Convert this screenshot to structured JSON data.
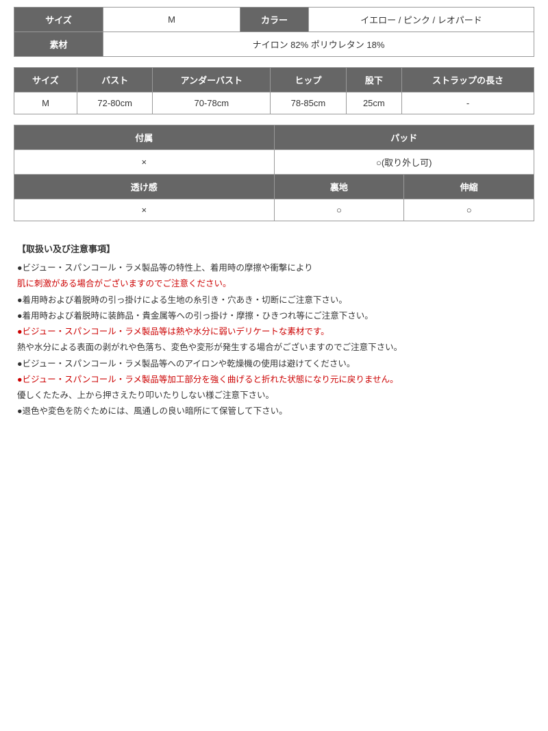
{
  "table1": {
    "row1": {
      "size_label": "サイズ",
      "size_value": "M",
      "color_label": "カラー",
      "color_value": "イエロー / ピンク / レオパード"
    },
    "row2": {
      "material_label": "素材",
      "material_value": "ナイロン 82%  ポリウレタン 18%"
    }
  },
  "table2": {
    "headers": [
      "サイズ",
      "バスト",
      "アンダーバスト",
      "ヒップ",
      "股下",
      "ストラップの長さ"
    ],
    "rows": [
      [
        "M",
        "72-80cm",
        "70-78cm",
        "78-85cm",
        "25cm",
        "-"
      ]
    ]
  },
  "table3": {
    "row1_headers": [
      "付属",
      "パッド"
    ],
    "row1_values": [
      "×",
      "○(取り外し可)"
    ],
    "row2_headers": [
      "透け感",
      "裏地",
      "伸縮"
    ],
    "row2_values": [
      "×",
      "○",
      "○"
    ]
  },
  "notes": {
    "title": "【取扱い及び注意事項】",
    "items": [
      {
        "text": "●ビジュー・スパンコール・ラメ製品等の特性上、着用時の摩擦や衝撃により",
        "red": false
      },
      {
        "text": "肌に刺激がある場合がございますのでご注意ください。",
        "red": true
      },
      {
        "text": "●着用時および着脱時の引っ掛けによる生地の糸引き・穴あき・切断にご注意下さい。",
        "red": false
      },
      {
        "text": "●着用時および着脱時に装飾品・貴金属等への引っ掛け・摩擦・ひきつれ等にご注意下さい。",
        "red": false
      },
      {
        "text": "●ビジュー・スパンコール・ラメ製品等は熱や水分に弱いデリケートな素材です。",
        "red": true
      },
      {
        "text": "熱や水分による表面の剥がれや色落ち、変色や変形が発生する場合がございますのでご注意下さい。",
        "red": false
      },
      {
        "text": "●ビジュー・スパンコール・ラメ製品等へのアイロンや乾燥機の使用は避けてください。",
        "red": false
      },
      {
        "text": "●ビジュー・スパンコール・ラメ製品等加工部分を強く曲げると折れた状態になり元に戻りません。",
        "red": true
      },
      {
        "text": "優しくたたみ、上から押さえたり叩いたりしない様ご注意下さい。",
        "red": false
      },
      {
        "text": "●退色や変色を防ぐためには、風通しの良い暗所にて保管して下さい。",
        "red": false
      }
    ]
  }
}
